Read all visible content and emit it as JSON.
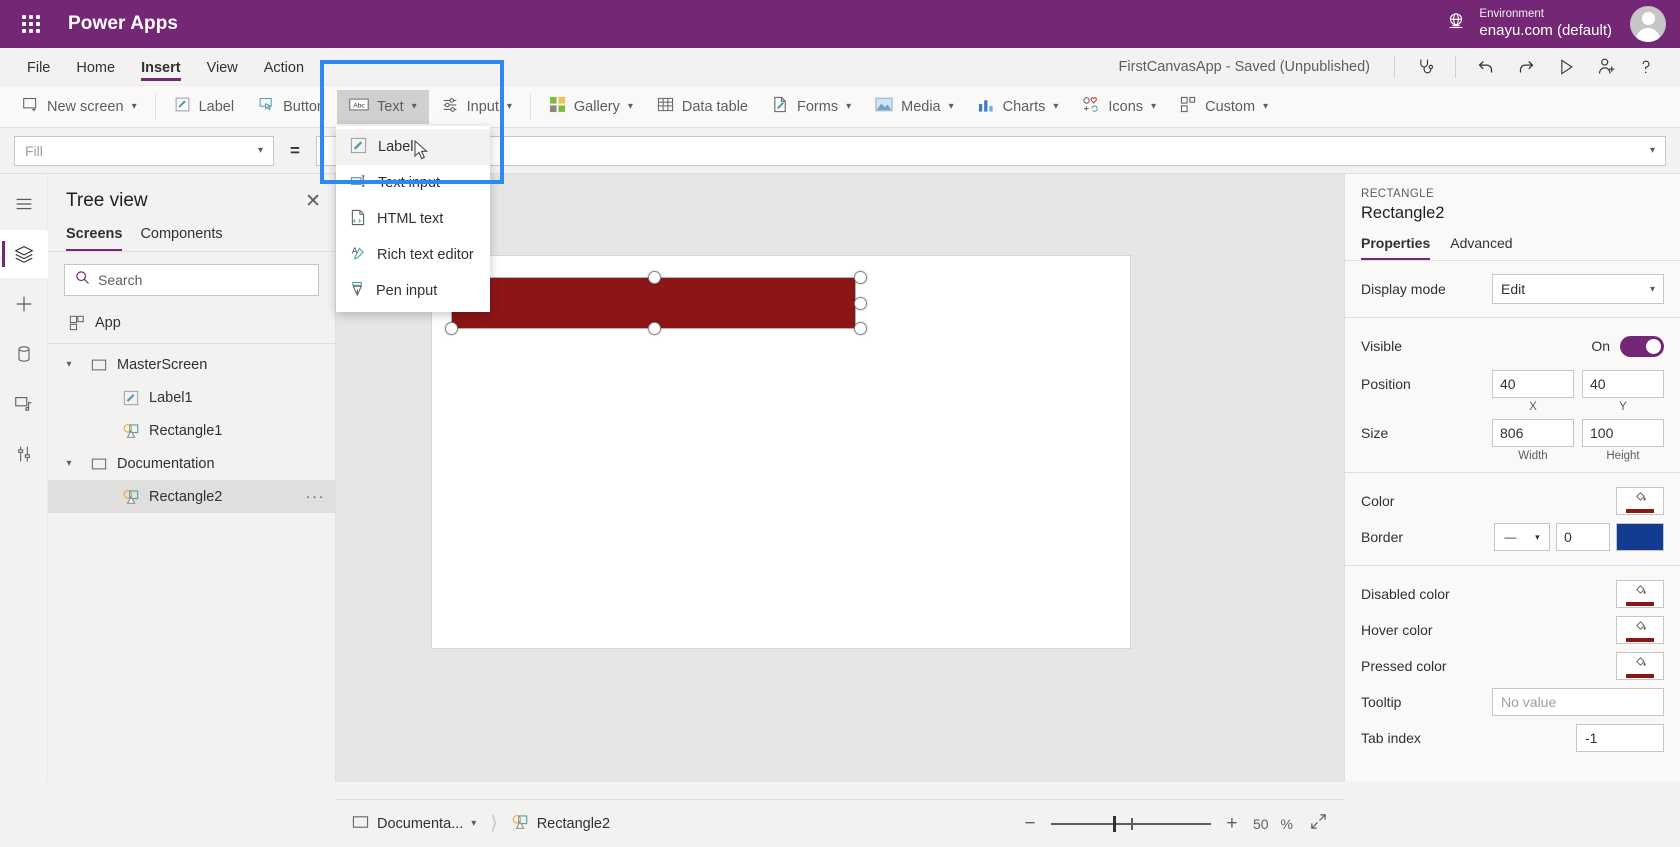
{
  "topbar": {
    "brand": "Power Apps",
    "waffle_icon": "app-launcher-icon",
    "globe_icon": "globe-icon",
    "environment_label": "Environment",
    "environment_value": "enayu.com (default)",
    "avatar": "user-avatar",
    "background": "#742774"
  },
  "menubar": {
    "items": [
      {
        "label": "File",
        "active": false
      },
      {
        "label": "Home",
        "active": false
      },
      {
        "label": "Insert",
        "active": true
      },
      {
        "label": "View",
        "active": false
      },
      {
        "label": "Action",
        "active": false
      }
    ],
    "app_status": "FirstCanvasApp - Saved (Unpublished)",
    "icons": [
      {
        "name": "app-checker-icon",
        "glyph": "⚕"
      },
      {
        "name": "undo-icon",
        "glyph": "↶"
      },
      {
        "name": "redo-icon",
        "glyph": "↷"
      },
      {
        "name": "preview-icon",
        "glyph": "▷"
      },
      {
        "name": "share-icon",
        "glyph": "☺"
      },
      {
        "name": "help-icon",
        "glyph": "?"
      }
    ]
  },
  "ribbon": {
    "items": [
      {
        "label": "New screen",
        "icon": "new-screen-icon",
        "caret": true
      },
      {
        "label": "Label",
        "icon": "label-icon",
        "caret": false
      },
      {
        "label": "Button",
        "icon": "button-icon",
        "caret": false
      },
      {
        "label": "Text",
        "icon": "text-abc-icon",
        "caret": true,
        "selected": true
      },
      {
        "label": "Input",
        "icon": "input-sliders-icon",
        "caret": true
      },
      {
        "label": "Gallery",
        "icon": "gallery-icon",
        "caret": true
      },
      {
        "label": "Data table",
        "icon": "data-table-icon",
        "caret": false
      },
      {
        "label": "Forms",
        "icon": "forms-icon",
        "caret": true
      },
      {
        "label": "Media",
        "icon": "media-icon",
        "caret": true
      },
      {
        "label": "Charts",
        "icon": "charts-icon",
        "caret": true
      },
      {
        "label": "Icons",
        "icon": "icons-icon",
        "caret": true
      },
      {
        "label": "Custom",
        "icon": "custom-icon",
        "caret": true
      }
    ]
  },
  "text_dropdown": {
    "items": [
      {
        "label": "Label",
        "icon": "label-icon",
        "highlighted": true
      },
      {
        "label": "Text input",
        "icon": "text-input-icon",
        "highlighted": false
      },
      {
        "label": "HTML text",
        "icon": "html-text-icon",
        "highlighted": false
      },
      {
        "label": "Rich text editor",
        "icon": "rich-text-editor-icon",
        "highlighted": false
      },
      {
        "label": "Pen input",
        "icon": "pen-input-icon",
        "highlighted": false
      }
    ],
    "highlight_color": "#2a8af0"
  },
  "formulabar": {
    "property_value": "Fill",
    "equals": "=",
    "formula_value": ""
  },
  "rail": {
    "items": [
      {
        "name": "hamburger-menu-icon",
        "active": false
      },
      {
        "name": "tree-view-icon",
        "active": true
      },
      {
        "name": "insert-plus-icon",
        "active": false
      },
      {
        "name": "data-sources-icon",
        "active": false
      },
      {
        "name": "media-library-icon",
        "active": false
      },
      {
        "name": "advanced-tools-icon",
        "active": false
      }
    ]
  },
  "treeview": {
    "title": "Tree view",
    "close_icon": "close-icon",
    "tabs": [
      {
        "label": "Screens",
        "active": true
      },
      {
        "label": "Components",
        "active": false
      }
    ],
    "search_placeholder": "Search",
    "search_value": "",
    "nodes": [
      {
        "label": "App",
        "icon": "app-icon",
        "indent": 0,
        "chevron": "",
        "selected": false,
        "dots": false
      },
      {
        "label": "MasterScreen",
        "icon": "screen-icon",
        "indent": 0,
        "chevron": "⌄",
        "selected": false,
        "dots": false
      },
      {
        "label": "Label1",
        "icon": "label-icon",
        "indent": 1,
        "chevron": "",
        "selected": false,
        "dots": false
      },
      {
        "label": "Rectangle1",
        "icon": "shape-icon",
        "indent": 1,
        "chevron": "",
        "selected": false,
        "dots": false
      },
      {
        "label": "Documentation",
        "icon": "screen-icon",
        "indent": 0,
        "chevron": "⌄",
        "selected": false,
        "dots": false
      },
      {
        "label": "Rectangle2",
        "icon": "shape-icon",
        "indent": 1,
        "chevron": "",
        "selected": true,
        "dots": true
      }
    ]
  },
  "canvas": {
    "shape_color": "#8C1515",
    "shape_name": "Rectangle2"
  },
  "properties": {
    "kind": "RECTANGLE",
    "name": "Rectangle2",
    "tabs": [
      {
        "label": "Properties",
        "active": true
      },
      {
        "label": "Advanced",
        "active": false
      }
    ],
    "display_mode": {
      "label": "Display mode",
      "value": "Edit"
    },
    "visible": {
      "label": "Visible",
      "state": "On"
    },
    "position": {
      "label": "Position",
      "x": "40",
      "y": "40",
      "x_cap": "X",
      "y_cap": "Y"
    },
    "size": {
      "label": "Size",
      "width": "806",
      "height": "100",
      "w_cap": "Width",
      "h_cap": "Height"
    },
    "color": {
      "label": "Color",
      "swatch": "#8C1515"
    },
    "border": {
      "label": "Border",
      "style": "—",
      "width": "0",
      "color": "#123A8F"
    },
    "disabled_color": {
      "label": "Disabled color",
      "swatch": "#8C1515"
    },
    "hover_color": {
      "label": "Hover color",
      "swatch": "#8C1515"
    },
    "pressed_color": {
      "label": "Pressed color",
      "swatch": "#8C1515"
    },
    "tooltip": {
      "label": "Tooltip",
      "placeholder": "No value"
    },
    "tab_index": {
      "label": "Tab index",
      "value": "-1"
    }
  },
  "statusbar": {
    "screen_crumb": "Documenta...",
    "control_crumb": "Rectangle2",
    "zoom_minus": "−",
    "zoom_plus": "+",
    "zoom_value": "50",
    "zoom_unit": "%",
    "fit_icon": "fit-to-screen-icon"
  }
}
